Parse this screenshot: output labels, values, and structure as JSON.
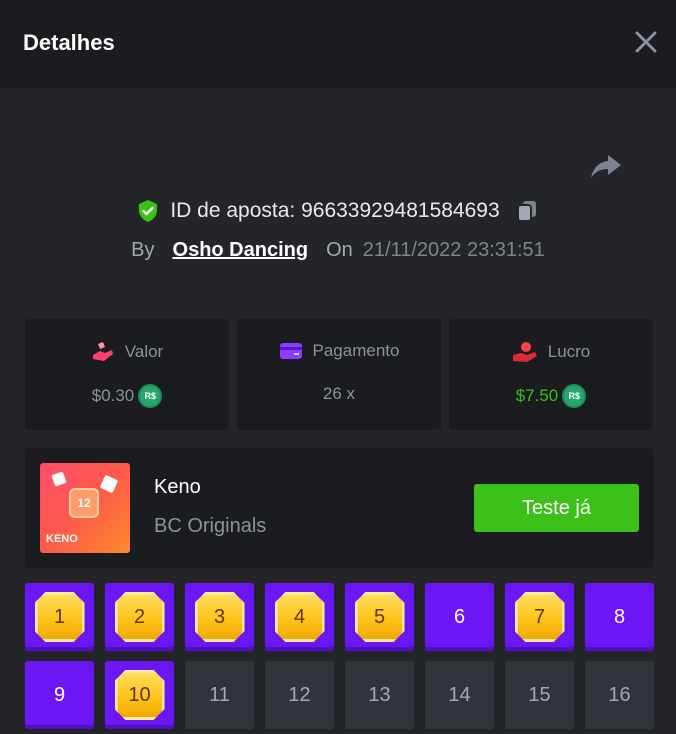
{
  "header": {
    "title": "Detalhes"
  },
  "bet": {
    "id_text": "ID de aposta: 96633929481584693",
    "by_label": "By",
    "user": "Osho Dancing",
    "on_label": "On",
    "date": "21/11/2022 23:31:51"
  },
  "cards": [
    {
      "label": "Valor",
      "value": "$0.30",
      "icon": "hand-coin-icon",
      "coin": "R$"
    },
    {
      "label": "Pagamento",
      "value": "26 x",
      "icon": "wallet-icon"
    },
    {
      "label": "Lucro",
      "value": "$7.50",
      "icon": "profit-hand-icon",
      "coin": "R$"
    }
  ],
  "game": {
    "name": "Keno",
    "provider": "BC Originals",
    "thumb_label": "KENO",
    "thumb_number": "12",
    "try_label": "Teste já"
  },
  "colors": {
    "accent_purple": "#6b17f5",
    "green": "#3bc117",
    "gold": "#ffc21a"
  },
  "tiles": [
    {
      "n": "1",
      "state": "hit"
    },
    {
      "n": "2",
      "state": "hit"
    },
    {
      "n": "3",
      "state": "hit"
    },
    {
      "n": "4",
      "state": "hit"
    },
    {
      "n": "5",
      "state": "hit"
    },
    {
      "n": "6",
      "state": "picked"
    },
    {
      "n": "7",
      "state": "hit"
    },
    {
      "n": "8",
      "state": "picked"
    },
    {
      "n": "9",
      "state": "picked"
    },
    {
      "n": "10",
      "state": "hit"
    },
    {
      "n": "11",
      "state": "none"
    },
    {
      "n": "12",
      "state": "none"
    },
    {
      "n": "13",
      "state": "none"
    },
    {
      "n": "14",
      "state": "none"
    },
    {
      "n": "15",
      "state": "none"
    },
    {
      "n": "16",
      "state": "none"
    }
  ]
}
